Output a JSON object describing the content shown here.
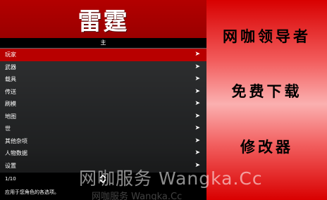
{
  "menu": {
    "title": "雷霆",
    "subtitle": "主",
    "items": [
      {
        "label": "玩家",
        "arrow": "➤",
        "selected": true
      },
      {
        "label": "武器",
        "arrow": "➤"
      },
      {
        "label": "载具",
        "arrow": "➤"
      },
      {
        "label": "传送",
        "arrow": "➤"
      },
      {
        "label": "刷模",
        "arrow": "➤"
      },
      {
        "label": "地图",
        "arrow": "➤"
      },
      {
        "label": "世",
        "arrow": "➤"
      },
      {
        "label": "其他杂项",
        "arrow": "➤"
      },
      {
        "label": "人物数据",
        "arrow": "➤"
      },
      {
        "label": "设置",
        "arrow": "➤"
      }
    ],
    "page_indicator": "1/10",
    "description": "应用于您角色的各选项。"
  },
  "ad": {
    "line1": "网咖领导者",
    "line2": "免费下载",
    "line3": "修改器"
  },
  "watermark": {
    "main": "网咖服务 Wangka.Cc",
    "shadow": "网咖服务 Wangka.Cc"
  },
  "colors": {
    "header_red": "#b30000",
    "selected_red": "#b80000",
    "ad_red": "#d80000"
  },
  "icons": {
    "submenu_arrow": "arrow-right-icon",
    "scroll": "up-down-arrows-icon"
  }
}
